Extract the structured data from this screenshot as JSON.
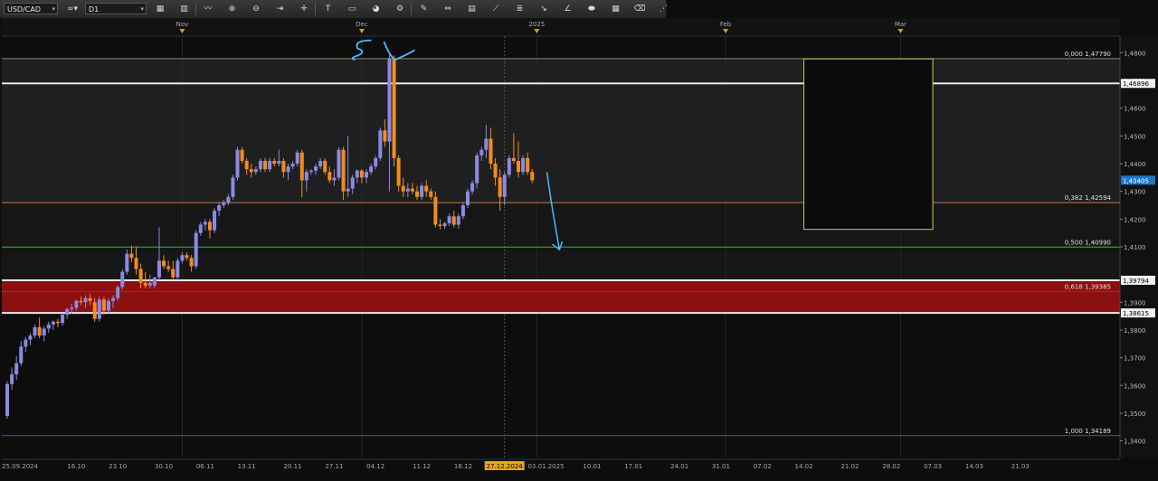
{
  "toolbar": {
    "symbol": "USD/CAD",
    "link_icon": "chain-link-icon",
    "timeframe": "D1",
    "tools": [
      {
        "name": "chart-type-icon",
        "glyph": "▦"
      },
      {
        "name": "bar-chart-icon",
        "glyph": "▥"
      },
      {
        "name": "line-chart-icon",
        "glyph": "〰"
      },
      {
        "name": "zoom-in-icon",
        "glyph": "⊕"
      },
      {
        "name": "zoom-out-icon",
        "glyph": "⊖"
      },
      {
        "name": "autoscroll-icon",
        "glyph": "⇥"
      },
      {
        "name": "crosshair-icon",
        "glyph": "✛"
      },
      {
        "name": "text-tool-icon",
        "glyph": "T"
      },
      {
        "name": "note-icon",
        "glyph": "▭"
      },
      {
        "name": "palette-icon",
        "glyph": "◕"
      },
      {
        "name": "settings-icon",
        "glyph": "⚙"
      },
      {
        "name": "pencil-icon",
        "glyph": "✎"
      },
      {
        "name": "horizontal-line-icon",
        "glyph": "⇔"
      },
      {
        "name": "trend-channel-icon",
        "glyph": "▤"
      },
      {
        "name": "trend-line-icon",
        "glyph": "⟋"
      },
      {
        "name": "fibonacci-icon",
        "glyph": "≣"
      },
      {
        "name": "ray-icon",
        "glyph": "↘"
      },
      {
        "name": "angle-icon",
        "glyph": "∠"
      },
      {
        "name": "shape-icon",
        "glyph": "⬬"
      },
      {
        "name": "grid-icon",
        "glyph": "▦"
      },
      {
        "name": "eraser-icon",
        "glyph": "⌫"
      },
      {
        "name": "more-tools-icon",
        "glyph": "⋰"
      }
    ]
  },
  "chart_data": {
    "type": "candlestick",
    "symbol": "USD/CAD",
    "timeframe": "D1",
    "price_axis": {
      "min": 1.334,
      "max": 1.486,
      "labels": [
        "1,4800",
        "1,4700",
        "1,4600",
        "1,4500",
        "1,4400",
        "1,4300",
        "1,4200",
        "1,4100",
        "1,3900",
        "1,3800",
        "1,3700",
        "1,3600",
        "1,3500",
        "1,3400"
      ],
      "label_values": [
        1.48,
        1.47,
        1.46,
        1.45,
        1.44,
        1.43,
        1.42,
        1.41,
        1.39,
        1.38,
        1.37,
        1.36,
        1.35,
        1.34
      ],
      "current_price": {
        "value": 1.43405,
        "label": "1,43405"
      }
    },
    "time_axis": {
      "bottom_labels": [
        {
          "idx": 0,
          "label": "25.09.2024"
        },
        {
          "idx": 15,
          "label": "16.10"
        },
        {
          "idx": 24,
          "label": "23.10"
        },
        {
          "idx": 34,
          "label": "30.10"
        },
        {
          "idx": 43,
          "label": "06.11"
        },
        {
          "idx": 52,
          "label": "13.11"
        },
        {
          "idx": 62,
          "label": "20.11"
        },
        {
          "idx": 71,
          "label": "27.11"
        },
        {
          "idx": 80,
          "label": "04.12"
        },
        {
          "idx": 90,
          "label": "11.12"
        },
        {
          "idx": 99,
          "label": "18.12"
        },
        {
          "idx": 108,
          "label": "27.12.2024",
          "highlight": true
        },
        {
          "idx": 117,
          "label": "03.01.2025"
        },
        {
          "idx": 127,
          "label": "10.01"
        },
        {
          "idx": 136,
          "label": "17.01"
        },
        {
          "idx": 146,
          "label": "24.01"
        },
        {
          "idx": 155,
          "label": "31.01"
        },
        {
          "idx": 164,
          "label": "07.02"
        },
        {
          "idx": 173,
          "label": "14.02"
        },
        {
          "idx": 183,
          "label": "21.02"
        },
        {
          "idx": 192,
          "label": "28.02"
        },
        {
          "idx": 201,
          "label": "07.03"
        },
        {
          "idx": 210,
          "label": "14.03"
        },
        {
          "idx": 220,
          "label": "21.03"
        }
      ],
      "top_labels": [
        {
          "idx": 38,
          "label": "Nov"
        },
        {
          "idx": 77,
          "label": "Dec"
        },
        {
          "idx": 115,
          "label": "2025"
        },
        {
          "idx": 156,
          "label": "Feb"
        },
        {
          "idx": 194,
          "label": "Mar"
        }
      ]
    },
    "horizontal_levels": [
      {
        "value": 1.46896,
        "label": "1,46896",
        "color": "#e8e8e8"
      },
      {
        "value": 1.39794,
        "label": "1,39794",
        "color": "#e8e8e8"
      },
      {
        "value": 1.38615,
        "label": "1,38615",
        "color": "#e8e8e8"
      }
    ],
    "fibonacci": [
      {
        "level": "0,000",
        "value": 1.4779,
        "label": "0,000 1,47790",
        "color": "#8c8c5a"
      },
      {
        "level": "0,382",
        "value": 1.42594,
        "label": "0,382 1,42594",
        "color": "#c8783c"
      },
      {
        "level": "0,500",
        "value": 1.4099,
        "label": "0,500 1,40990",
        "color": "#3cb43c"
      },
      {
        "level": "0,618",
        "value": 1.39385,
        "label": "0,618 1,39385",
        "color": "#3c3cc8"
      },
      {
        "level": "1,000",
        "value": 1.34189,
        "label": "1,000 1,34189",
        "color": "#8c3c8c"
      }
    ],
    "zone": {
      "from": 1.38615,
      "to": 1.39794,
      "color": "#8b1111"
    },
    "rectangle": {
      "x_start_idx": 173,
      "x_end_idx": 201,
      "price_low": 1.4163,
      "price_high": 1.4778,
      "color": "#c8c864"
    },
    "annotations": {
      "handwritten_text": "SL",
      "forecast_arrow": "down"
    },
    "bull_color": "#8a8ae6",
    "bear_color": "#f28c1e",
    "candles": [
      {
        "o": 1.349,
        "h": 1.3615,
        "l": 1.348,
        "c": 1.3605
      },
      {
        "o": 1.3605,
        "h": 1.3665,
        "l": 1.3585,
        "c": 1.364
      },
      {
        "o": 1.364,
        "h": 1.3705,
        "l": 1.362,
        "c": 1.368
      },
      {
        "o": 1.368,
        "h": 1.376,
        "l": 1.367,
        "c": 1.374
      },
      {
        "o": 1.374,
        "h": 1.3775,
        "l": 1.372,
        "c": 1.3765
      },
      {
        "o": 1.3765,
        "h": 1.379,
        "l": 1.3745,
        "c": 1.378
      },
      {
        "o": 1.378,
        "h": 1.382,
        "l": 1.377,
        "c": 1.381
      },
      {
        "o": 1.381,
        "h": 1.3845,
        "l": 1.377,
        "c": 1.378
      },
      {
        "o": 1.378,
        "h": 1.3815,
        "l": 1.376,
        "c": 1.3805
      },
      {
        "o": 1.3805,
        "h": 1.383,
        "l": 1.379,
        "c": 1.382
      },
      {
        "o": 1.382,
        "h": 1.3835,
        "l": 1.38,
        "c": 1.383
      },
      {
        "o": 1.383,
        "h": 1.384,
        "l": 1.381,
        "c": 1.3825
      },
      {
        "o": 1.3825,
        "h": 1.386,
        "l": 1.3815,
        "c": 1.3855
      },
      {
        "o": 1.3855,
        "h": 1.388,
        "l": 1.384,
        "c": 1.3875
      },
      {
        "o": 1.3875,
        "h": 1.3895,
        "l": 1.386,
        "c": 1.388
      },
      {
        "o": 1.388,
        "h": 1.391,
        "l": 1.387,
        "c": 1.3905
      },
      {
        "o": 1.3905,
        "h": 1.392,
        "l": 1.389,
        "c": 1.39
      },
      {
        "o": 1.39,
        "h": 1.3925,
        "l": 1.388,
        "c": 1.3915
      },
      {
        "o": 1.3915,
        "h": 1.393,
        "l": 1.389,
        "c": 1.3905
      },
      {
        "o": 1.39,
        "h": 1.3915,
        "l": 1.383,
        "c": 1.384
      },
      {
        "o": 1.384,
        "h": 1.392,
        "l": 1.383,
        "c": 1.391
      },
      {
        "o": 1.391,
        "h": 1.392,
        "l": 1.3855,
        "c": 1.387
      },
      {
        "o": 1.387,
        "h": 1.3915,
        "l": 1.386,
        "c": 1.3905
      },
      {
        "o": 1.3905,
        "h": 1.3925,
        "l": 1.388,
        "c": 1.3915
      },
      {
        "o": 1.3915,
        "h": 1.396,
        "l": 1.3905,
        "c": 1.3955
      },
      {
        "o": 1.3955,
        "h": 1.402,
        "l": 1.3945,
        "c": 1.401
      },
      {
        "o": 1.401,
        "h": 1.409,
        "l": 1.4,
        "c": 1.4075
      },
      {
        "o": 1.4075,
        "h": 1.4105,
        "l": 1.4045,
        "c": 1.406
      },
      {
        "o": 1.406,
        "h": 1.41,
        "l": 1.4,
        "c": 1.402
      },
      {
        "o": 1.402,
        "h": 1.404,
        "l": 1.395,
        "c": 1.397
      },
      {
        "o": 1.397,
        "h": 1.401,
        "l": 1.395,
        "c": 1.396
      },
      {
        "o": 1.396,
        "h": 1.4,
        "l": 1.395,
        "c": 1.397
      },
      {
        "o": 1.396,
        "h": 1.399,
        "l": 1.395,
        "c": 1.399
      },
      {
        "o": 1.399,
        "h": 1.417,
        "l": 1.398,
        "c": 1.405
      },
      {
        "o": 1.405,
        "h": 1.407,
        "l": 1.402,
        "c": 1.403
      },
      {
        "o": 1.403,
        "h": 1.405,
        "l": 1.401,
        "c": 1.402
      },
      {
        "o": 1.402,
        "h": 1.405,
        "l": 1.398,
        "c": 1.399
      },
      {
        "o": 1.399,
        "h": 1.406,
        "l": 1.398,
        "c": 1.405
      },
      {
        "o": 1.405,
        "h": 1.408,
        "l": 1.404,
        "c": 1.407
      },
      {
        "o": 1.407,
        "h": 1.408,
        "l": 1.405,
        "c": 1.406
      },
      {
        "o": 1.406,
        "h": 1.407,
        "l": 1.401,
        "c": 1.403
      },
      {
        "o": 1.403,
        "h": 1.416,
        "l": 1.402,
        "c": 1.415
      },
      {
        "o": 1.415,
        "h": 1.419,
        "l": 1.414,
        "c": 1.418
      },
      {
        "o": 1.418,
        "h": 1.42,
        "l": 1.416,
        "c": 1.419
      },
      {
        "o": 1.419,
        "h": 1.42,
        "l": 1.413,
        "c": 1.416
      },
      {
        "o": 1.416,
        "h": 1.424,
        "l": 1.415,
        "c": 1.423
      },
      {
        "o": 1.423,
        "h": 1.426,
        "l": 1.421,
        "c": 1.425
      },
      {
        "o": 1.425,
        "h": 1.427,
        "l": 1.424,
        "c": 1.426
      },
      {
        "o": 1.426,
        "h": 1.429,
        "l": 1.425,
        "c": 1.428
      },
      {
        "o": 1.428,
        "h": 1.436,
        "l": 1.427,
        "c": 1.435
      },
      {
        "o": 1.435,
        "h": 1.446,
        "l": 1.434,
        "c": 1.445
      },
      {
        "o": 1.445,
        "h": 1.446,
        "l": 1.44,
        "c": 1.441
      },
      {
        "o": 1.441,
        "h": 1.442,
        "l": 1.436,
        "c": 1.438
      },
      {
        "o": 1.438,
        "h": 1.44,
        "l": 1.435,
        "c": 1.437
      },
      {
        "o": 1.437,
        "h": 1.439,
        "l": 1.436,
        "c": 1.438
      },
      {
        "o": 1.438,
        "h": 1.442,
        "l": 1.437,
        "c": 1.441
      },
      {
        "o": 1.441,
        "h": 1.442,
        "l": 1.437,
        "c": 1.438
      },
      {
        "o": 1.438,
        "h": 1.442,
        "l": 1.437,
        "c": 1.441
      },
      {
        "o": 1.441,
        "h": 1.442,
        "l": 1.439,
        "c": 1.44
      },
      {
        "o": 1.44,
        "h": 1.445,
        "l": 1.439,
        "c": 1.441
      },
      {
        "o": 1.441,
        "h": 1.442,
        "l": 1.435,
        "c": 1.437
      },
      {
        "o": 1.437,
        "h": 1.44,
        "l": 1.434,
        "c": 1.439
      },
      {
        "o": 1.439,
        "h": 1.441,
        "l": 1.438,
        "c": 1.44
      },
      {
        "o": 1.44,
        "h": 1.445,
        "l": 1.439,
        "c": 1.444
      },
      {
        "o": 1.444,
        "h": 1.445,
        "l": 1.428,
        "c": 1.434
      },
      {
        "o": 1.434,
        "h": 1.438,
        "l": 1.43,
        "c": 1.437
      },
      {
        "o": 1.437,
        "h": 1.438,
        "l": 1.436,
        "c": 1.4375
      },
      {
        "o": 1.4375,
        "h": 1.44,
        "l": 1.436,
        "c": 1.439
      },
      {
        "o": 1.439,
        "h": 1.442,
        "l": 1.438,
        "c": 1.441
      },
      {
        "o": 1.441,
        "h": 1.442,
        "l": 1.436,
        "c": 1.437
      },
      {
        "o": 1.437,
        "h": 1.439,
        "l": 1.433,
        "c": 1.434
      },
      {
        "o": 1.434,
        "h": 1.438,
        "l": 1.432,
        "c": 1.435
      },
      {
        "o": 1.435,
        "h": 1.446,
        "l": 1.434,
        "c": 1.445
      },
      {
        "o": 1.445,
        "h": 1.446,
        "l": 1.427,
        "c": 1.43
      },
      {
        "o": 1.43,
        "h": 1.45,
        "l": 1.428,
        "c": 1.431
      },
      {
        "o": 1.431,
        "h": 1.436,
        "l": 1.429,
        "c": 1.435
      },
      {
        "o": 1.435,
        "h": 1.438,
        "l": 1.433,
        "c": 1.4375
      },
      {
        "o": 1.4375,
        "h": 1.438,
        "l": 1.433,
        "c": 1.435
      },
      {
        "o": 1.435,
        "h": 1.438,
        "l": 1.433,
        "c": 1.437
      },
      {
        "o": 1.437,
        "h": 1.44,
        "l": 1.436,
        "c": 1.439
      },
      {
        "o": 1.439,
        "h": 1.443,
        "l": 1.438,
        "c": 1.442
      },
      {
        "o": 1.442,
        "h": 1.453,
        "l": 1.441,
        "c": 1.452
      },
      {
        "o": 1.452,
        "h": 1.456,
        "l": 1.446,
        "c": 1.448
      },
      {
        "o": 1.448,
        "h": 1.48,
        "l": 1.43,
        "c": 1.478
      },
      {
        "o": 1.478,
        "h": 1.479,
        "l": 1.439,
        "c": 1.442
      },
      {
        "o": 1.442,
        "h": 1.443,
        "l": 1.43,
        "c": 1.432
      },
      {
        "o": 1.432,
        "h": 1.435,
        "l": 1.428,
        "c": 1.43
      },
      {
        "o": 1.43,
        "h": 1.433,
        "l": 1.428,
        "c": 1.431
      },
      {
        "o": 1.431,
        "h": 1.433,
        "l": 1.429,
        "c": 1.43
      },
      {
        "o": 1.43,
        "h": 1.432,
        "l": 1.427,
        "c": 1.428
      },
      {
        "o": 1.428,
        "h": 1.433,
        "l": 1.427,
        "c": 1.432
      },
      {
        "o": 1.432,
        "h": 1.434,
        "l": 1.428,
        "c": 1.43
      },
      {
        "o": 1.43,
        "h": 1.431,
        "l": 1.427,
        "c": 1.428
      },
      {
        "o": 1.428,
        "h": 1.43,
        "l": 1.417,
        "c": 1.418
      },
      {
        "o": 1.418,
        "h": 1.42,
        "l": 1.4163,
        "c": 1.4175
      },
      {
        "o": 1.4175,
        "h": 1.419,
        "l": 1.4165,
        "c": 1.4185
      },
      {
        "o": 1.4185,
        "h": 1.422,
        "l": 1.4175,
        "c": 1.421
      },
      {
        "o": 1.421,
        "h": 1.423,
        "l": 1.417,
        "c": 1.418
      },
      {
        "o": 1.418,
        "h": 1.422,
        "l": 1.4165,
        "c": 1.421
      },
      {
        "o": 1.421,
        "h": 1.426,
        "l": 1.42,
        "c": 1.425
      },
      {
        "o": 1.425,
        "h": 1.431,
        "l": 1.424,
        "c": 1.43
      },
      {
        "o": 1.43,
        "h": 1.434,
        "l": 1.429,
        "c": 1.433
      },
      {
        "o": 1.433,
        "h": 1.444,
        "l": 1.431,
        "c": 1.443
      },
      {
        "o": 1.443,
        "h": 1.446,
        "l": 1.441,
        "c": 1.445
      },
      {
        "o": 1.445,
        "h": 1.454,
        "l": 1.442,
        "c": 1.449
      },
      {
        "o": 1.449,
        "h": 1.453,
        "l": 1.438,
        "c": 1.44
      },
      {
        "o": 1.44,
        "h": 1.442,
        "l": 1.432,
        "c": 1.435
      },
      {
        "o": 1.435,
        "h": 1.438,
        "l": 1.423,
        "c": 1.428
      },
      {
        "o": 1.428,
        "h": 1.437,
        "l": 1.425,
        "c": 1.436
      },
      {
        "o": 1.436,
        "h": 1.443,
        "l": 1.435,
        "c": 1.442
      },
      {
        "o": 1.442,
        "h": 1.451,
        "l": 1.44,
        "c": 1.441
      },
      {
        "o": 1.441,
        "h": 1.448,
        "l": 1.435,
        "c": 1.437
      },
      {
        "o": 1.437,
        "h": 1.443,
        "l": 1.436,
        "c": 1.442
      },
      {
        "o": 1.442,
        "h": 1.444,
        "l": 1.436,
        "c": 1.437
      },
      {
        "o": 1.437,
        "h": 1.438,
        "l": 1.433,
        "c": 1.434
      }
    ]
  }
}
